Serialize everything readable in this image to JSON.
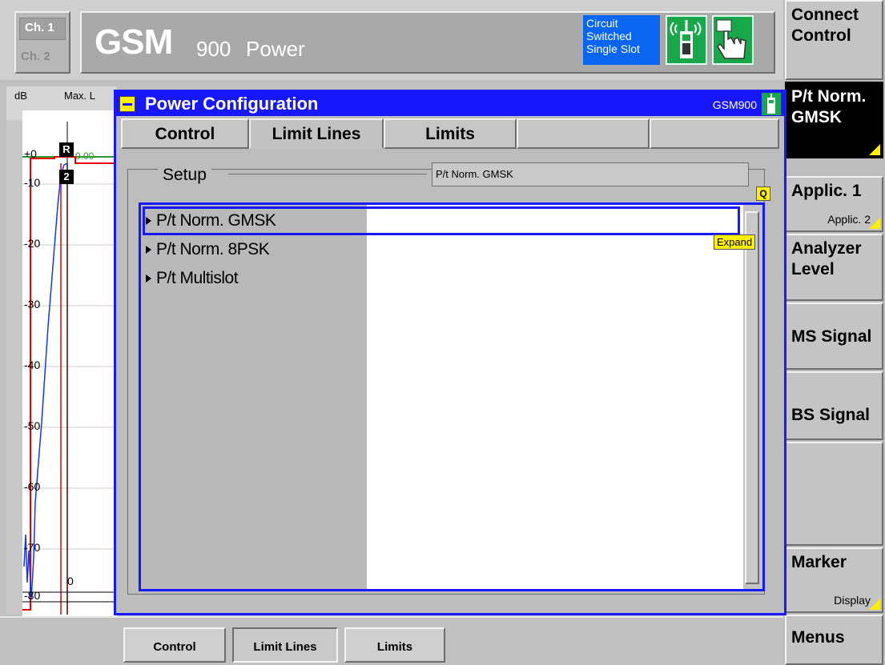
{
  "header": {
    "ch1": "Ch. 1",
    "ch2": "Ch. 2",
    "title": "GSM",
    "band": "900",
    "subtitle": "Power",
    "mode_lines": [
      "Circuit",
      "Switched",
      "Single Slot"
    ]
  },
  "softkeys": [
    {
      "label": "Connect Control",
      "sub": ""
    },
    {
      "label": "P/t Norm. GMSK",
      "sub": "",
      "active": true
    },
    {
      "label": "Applic. 1",
      "sub": "Applic. 2"
    },
    {
      "label": "Analyzer Level",
      "sub": ""
    },
    {
      "label": "MS Signal",
      "sub": ""
    },
    {
      "label": "BS Signal",
      "sub": ""
    },
    {
      "label": "",
      "sub": ""
    },
    {
      "label": "Marker",
      "sub": "Display"
    },
    {
      "label": "Menus",
      "sub": ""
    }
  ],
  "graph": {
    "unit": "dB",
    "max_label": "Max. L",
    "y_labels": [
      "+0",
      "-10",
      "-20",
      "-30",
      "-40",
      "-50",
      "-60",
      "-70",
      "-80"
    ],
    "x_zero": "0",
    "marker_r": "R",
    "marker_2": "2",
    "marker_val": "0.00"
  },
  "dialog": {
    "title": "Power Configuration",
    "standard": "GSM900",
    "tabs": [
      "Control",
      "Limit Lines",
      "Limits",
      "",
      ""
    ],
    "selected_tab": "Limit Lines",
    "setup_label": "Setup",
    "setup_value": "P/t Norm. GMSK",
    "q_icon": "Q",
    "tree_items": [
      "P/t Norm. GMSK",
      "P/t Norm. 8PSK",
      "P/t Multislot"
    ],
    "expand_label": "Expand"
  },
  "bottom_tabs": [
    "Control",
    "Limit Lines",
    "Limits"
  ]
}
